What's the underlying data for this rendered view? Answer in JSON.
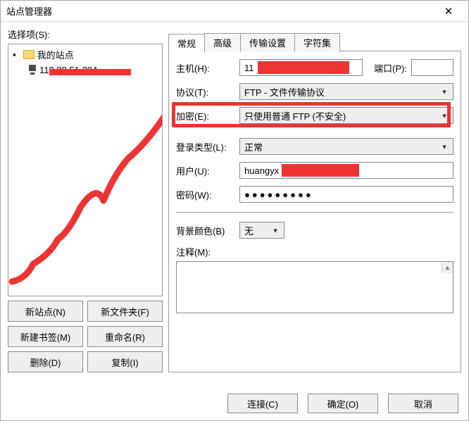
{
  "window": {
    "title": "站点管理器"
  },
  "left": {
    "select_label": "选择项(S):",
    "root_label": "我的站点",
    "site_label": "118.89.51.204",
    "buttons": {
      "new_site": "新站点(N)",
      "new_folder": "新文件夹(F)",
      "new_bookmark": "新建书签(M)",
      "rename": "重命名(R)",
      "delete": "删除(D)",
      "copy": "复制(I)"
    }
  },
  "tabs": [
    "常规",
    "高级",
    "传输设置",
    "字符集"
  ],
  "form": {
    "host_label": "主机(H):",
    "host_value": "11",
    "port_label": "端口(P):",
    "port_value": "",
    "protocol_label": "协议(T):",
    "protocol_value": "FTP - 文件传输协议",
    "encryption_label": "加密(E):",
    "encryption_value": "只使用普通 FTP (不安全)",
    "login_type_label": "登录类型(L):",
    "login_type_value": "正常",
    "user_label": "用户(U):",
    "user_value": "huangyx",
    "password_label": "密码(W):",
    "password_value": "●●●●●●●●●",
    "bgcolor_label": "背景颜色(B)",
    "bgcolor_value": "无",
    "comment_label": "注释(M):"
  },
  "dialog_buttons": {
    "connect": "连接(C)",
    "ok": "确定(O)",
    "cancel": "取消"
  },
  "annotations": {
    "encryption_highlight_color": "#e33",
    "redact_color": "#e33"
  }
}
